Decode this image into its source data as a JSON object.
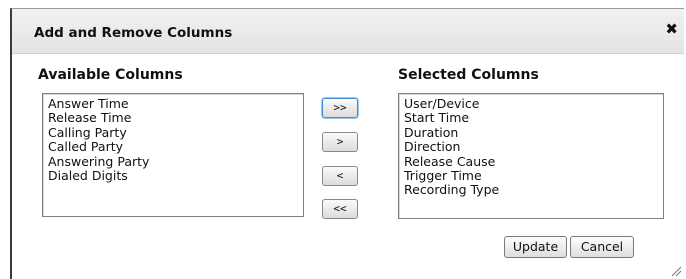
{
  "dialog": {
    "title": "Add and Remove Columns",
    "close_icon": "close-icon"
  },
  "available": {
    "heading": "Available Columns",
    "items": [
      "Answer Time",
      "Release Time",
      "Calling Party",
      "Called Party",
      "Answering Party",
      "Dialed Digits"
    ]
  },
  "selected": {
    "heading": "Selected Columns",
    "items": [
      "User/Device",
      "Start Time",
      "Duration",
      "Direction",
      "Release Cause",
      "Trigger Time",
      "Recording Type"
    ]
  },
  "transfer_buttons": {
    "add_all": ">>",
    "add": ">",
    "remove": "<",
    "remove_all": "<<"
  },
  "actions": {
    "update": "Update",
    "cancel": "Cancel"
  }
}
